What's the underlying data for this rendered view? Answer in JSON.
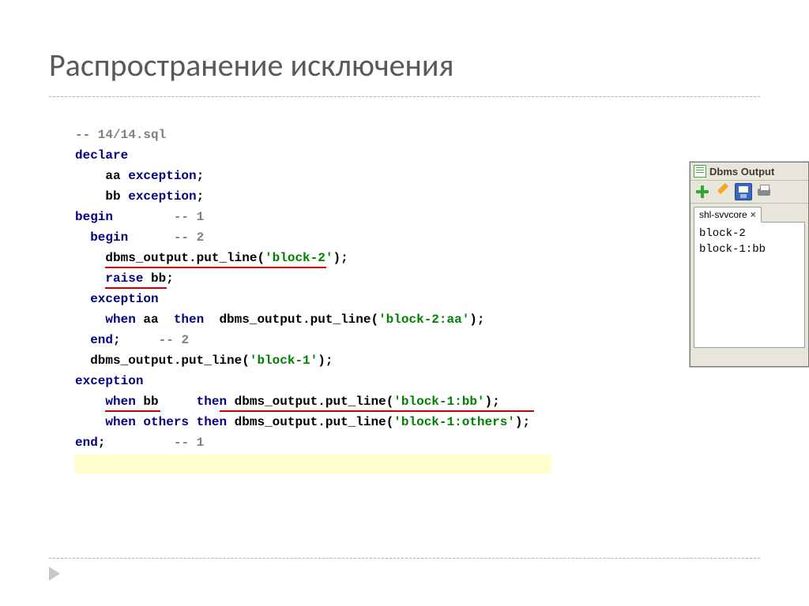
{
  "slide": {
    "title": "Распространение исключения"
  },
  "code": {
    "l1_comment": "-- 14/14.sql",
    "l2_declare": "declare",
    "l3_aa": "aa",
    "l3_exc": "exception",
    "l3_semi": ";",
    "l4_bb": "bb",
    "l4_exc": "exception",
    "l4_semi": ";",
    "l5_begin": "begin",
    "l5_cmt": "-- 1",
    "l6_begin": "begin",
    "l6_cmt": "-- 2",
    "l7_call": "dbms_output.put_line(",
    "l7_str": "'block-2'",
    "l7_end": ");",
    "l8_raise": "raise",
    "l8_bb": "bb;",
    "l9_exc": "exception",
    "l10_when": "when",
    "l10_aa": "aa",
    "l10_then": "then",
    "l10_call": "dbms_output.put_line(",
    "l10_str": "'block-2:aa'",
    "l10_end": ");",
    "l11_end": "end",
    "l11_semi": ";",
    "l11_cmt": "-- 2",
    "l12_call": "dbms_output.put_line(",
    "l12_str": "'block-1'",
    "l12_end": ");",
    "l13_exc": "exception",
    "l14_when": "when",
    "l14_bb": "bb",
    "l14_then": "then",
    "l14_call": "dbms_output.put_line(",
    "l14_str": "'block-1:bb'",
    "l14_end": ");",
    "l15_when": "when",
    "l15_others": "others",
    "l15_then": "then",
    "l15_call": "dbms_output.put_line(",
    "l15_str": "'block-1:others'",
    "l15_end": ");",
    "l16_end": "end",
    "l16_semi": ";",
    "l16_cmt": "-- 1"
  },
  "panel": {
    "title": "Dbms Output",
    "tab": "shl-svvcore",
    "output_line1": "block-2",
    "output_line2": "block-1:bb"
  }
}
